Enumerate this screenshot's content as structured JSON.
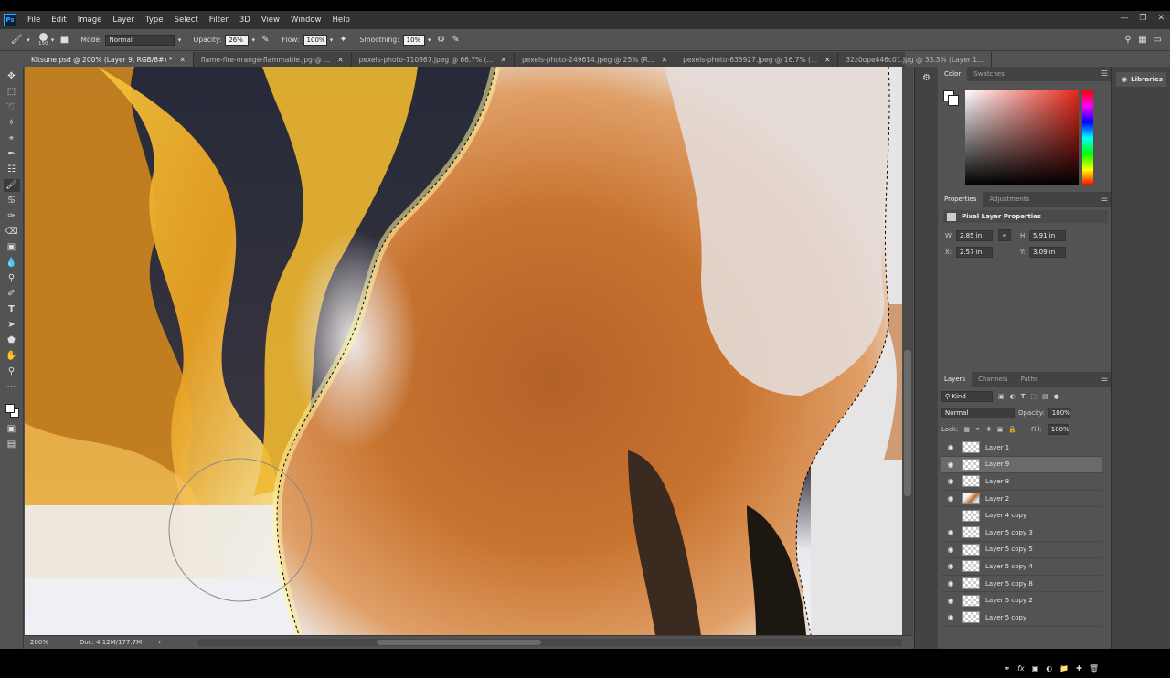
{
  "menubar": {
    "logo": "Ps",
    "items": [
      "File",
      "Edit",
      "Image",
      "Layer",
      "Type",
      "Select",
      "Filter",
      "3D",
      "View",
      "Window",
      "Help"
    ]
  },
  "options": {
    "brush_size": "150",
    "mode_label": "Mode:",
    "mode_value": "Normal",
    "opacity_label": "Opacity:",
    "opacity_value": "26%",
    "flow_label": "Flow:",
    "flow_value": "100%",
    "smoothing_label": "Smoothing:",
    "smoothing_value": "10%"
  },
  "tabs": [
    {
      "label": "Kitsune.psd @ 200% (Layer 9, RGB/8#) *",
      "active": true
    },
    {
      "label": "flame-fire-orange-flammable.jpg @ ..."
    },
    {
      "label": "pexels-photo-110867.jpeg @ 66.7% (..."
    },
    {
      "label": "pexels-photo-249614.jpeg @ 25% (R..."
    },
    {
      "label": "pexels-photo-635927.jpeg @ 16.7% (..."
    },
    {
      "label": "32z0ope446c01.jpg @ 33.3% (Layer 1..."
    }
  ],
  "status": {
    "zoom": "200%",
    "doc": "Doc: 4.12M/177.7M"
  },
  "color_panel": {
    "tabs": [
      "Color",
      "Swatches"
    ]
  },
  "properties": {
    "tabs": [
      "Properties",
      "Adjustments"
    ],
    "title": "Pixel Layer Properties",
    "w_label": "W:",
    "w_value": "2.85 in",
    "h_label": "H:",
    "h_value": "5.91 in",
    "x_label": "X:",
    "x_value": "2.57 in",
    "y_label": "Y:",
    "y_value": "3.09 in"
  },
  "layers_panel": {
    "tabs": [
      "Layers",
      "Channels",
      "Paths"
    ],
    "kind": "Kind",
    "blend": "Normal",
    "opacity_label": "Opacity:",
    "opacity_value": "100%",
    "lock_label": "Lock:",
    "fill_label": "Fill:",
    "fill_value": "100%",
    "layers": [
      {
        "name": "Layer 1",
        "visible": true
      },
      {
        "name": "Layer 9",
        "visible": true,
        "selected": true
      },
      {
        "name": "Layer 8",
        "visible": true
      },
      {
        "name": "Layer 2",
        "visible": true,
        "thumb": "fox"
      },
      {
        "name": "Layer 4 copy",
        "visible": false
      },
      {
        "name": "Layer 5 copy 3",
        "visible": true
      },
      {
        "name": "Layer 5 copy 5",
        "visible": true
      },
      {
        "name": "Layer 5 copy 4",
        "visible": true
      },
      {
        "name": "Layer 5 copy 8",
        "visible": true
      },
      {
        "name": "Layer 5 copy 2",
        "visible": true
      },
      {
        "name": "Layer 5 copy",
        "visible": true
      }
    ]
  },
  "libraries": {
    "label": "Libraries"
  }
}
